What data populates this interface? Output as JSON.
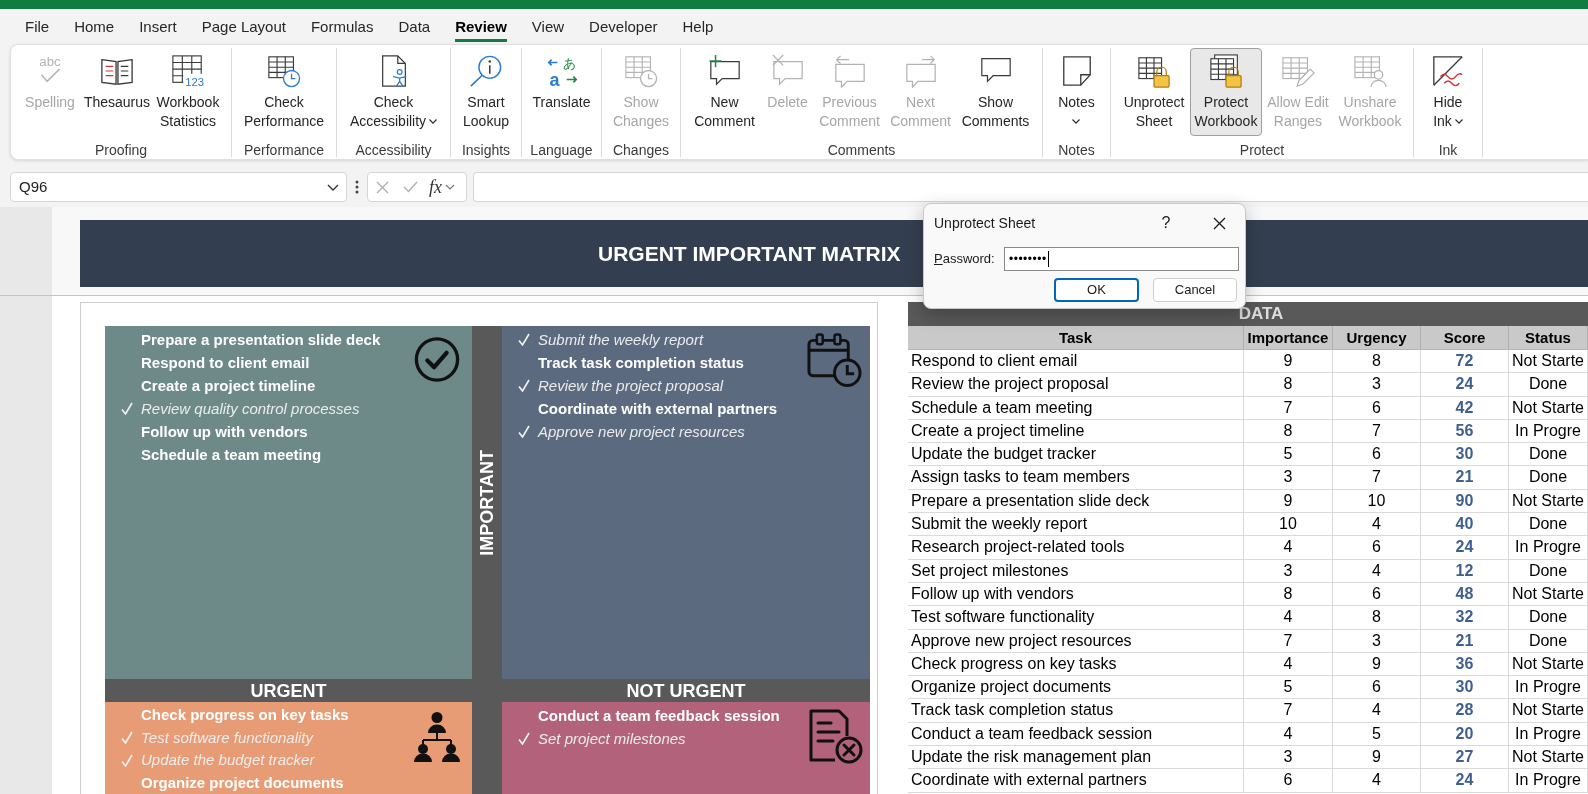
{
  "menu_tabs": [
    {
      "label": "File",
      "selected": false
    },
    {
      "label": "Home",
      "selected": false
    },
    {
      "label": "Insert",
      "selected": false
    },
    {
      "label": "Page Layout",
      "selected": false
    },
    {
      "label": "Formulas",
      "selected": false
    },
    {
      "label": "Data",
      "selected": false
    },
    {
      "label": "Review",
      "selected": true
    },
    {
      "label": "View",
      "selected": false
    },
    {
      "label": "Developer",
      "selected": false
    },
    {
      "label": "Help",
      "selected": false
    }
  ],
  "ribbon": {
    "groups": [
      {
        "label": "Proofing",
        "buttons": [
          {
            "lines": [
              "Spelling"
            ],
            "icon_text": [
              "abc"
            ],
            "disabled": true,
            "pressed": false,
            "dropdown": false
          },
          {
            "lines": [
              "Thesaurus"
            ],
            "disabled": false,
            "pressed": false,
            "dropdown": false
          },
          {
            "lines": [
              "Workbook",
              "Statistics"
            ],
            "icon_text": [
              "123"
            ],
            "disabled": false,
            "pressed": false,
            "dropdown": false
          }
        ]
      },
      {
        "label": "Performance",
        "buttons": [
          {
            "lines": [
              "Check",
              "Performance"
            ],
            "disabled": false,
            "pressed": false,
            "dropdown": false
          }
        ]
      },
      {
        "label": "Accessibility",
        "buttons": [
          {
            "lines": [
              "Check",
              "Accessibility"
            ],
            "disabled": false,
            "pressed": false,
            "dropdown": true
          }
        ]
      },
      {
        "label": "Insights",
        "buttons": [
          {
            "lines": [
              "Smart",
              "Lookup"
            ],
            "disabled": false,
            "pressed": false,
            "dropdown": false
          }
        ]
      },
      {
        "label": "Language",
        "buttons": [
          {
            "lines": [
              "Translate"
            ],
            "icon_text": [
              "a",
              "あ"
            ],
            "disabled": false,
            "pressed": false,
            "dropdown": false
          }
        ]
      },
      {
        "label": "Changes",
        "buttons": [
          {
            "lines": [
              "Show",
              "Changes"
            ],
            "disabled": true,
            "pressed": false,
            "dropdown": false
          }
        ]
      },
      {
        "label": "Comments",
        "buttons": [
          {
            "lines": [
              "New",
              "Comment"
            ],
            "disabled": false,
            "pressed": false,
            "dropdown": false
          },
          {
            "lines": [
              "Delete"
            ],
            "disabled": true,
            "pressed": false,
            "dropdown": false
          },
          {
            "lines": [
              "Previous",
              "Comment"
            ],
            "disabled": true,
            "pressed": false,
            "dropdown": false
          },
          {
            "lines": [
              "Next",
              "Comment"
            ],
            "disabled": true,
            "pressed": false,
            "dropdown": false
          },
          {
            "lines": [
              "Show",
              "Comments"
            ],
            "disabled": false,
            "pressed": false,
            "dropdown": false
          }
        ]
      },
      {
        "label": "Notes",
        "buttons": [
          {
            "lines": [
              "Notes"
            ],
            "disabled": false,
            "pressed": false,
            "dropdown": true
          }
        ]
      },
      {
        "label": "Protect",
        "buttons": [
          {
            "lines": [
              "Unprotect",
              "Sheet"
            ],
            "disabled": false,
            "pressed": false,
            "dropdown": false
          },
          {
            "lines": [
              "Protect",
              "Workbook"
            ],
            "disabled": false,
            "pressed": true,
            "dropdown": false
          },
          {
            "lines": [
              "Allow Edit",
              "Ranges"
            ],
            "disabled": true,
            "pressed": false,
            "dropdown": false
          },
          {
            "lines": [
              "Unshare",
              "Workbook"
            ],
            "disabled": true,
            "pressed": false,
            "dropdown": false
          }
        ]
      },
      {
        "label": "Ink",
        "buttons": [
          {
            "lines": [
              "Hide",
              "Ink"
            ],
            "disabled": false,
            "pressed": false,
            "dropdown": true
          }
        ]
      }
    ]
  },
  "formula_bar": {
    "name_box": "Q96",
    "function_button": "fx"
  },
  "sheet": {
    "title": "URGENT IMPORTANT MATRIX",
    "matrix": {
      "row_label": "IMPORTANT",
      "column_labels": [
        "URGENT",
        "NOT URGENT"
      ],
      "quadrants": [
        {
          "color": "#6d8a88",
          "items": [
            {
              "text": "Prepare a presentation slide deck",
              "checked": false
            },
            {
              "text": "Respond to client email",
              "checked": false
            },
            {
              "text": "Create a project timeline",
              "checked": false
            },
            {
              "text": "Review quality control processes",
              "checked": true
            },
            {
              "text": "Follow up with vendors",
              "checked": false
            },
            {
              "text": "Schedule a team meeting",
              "checked": false
            }
          ]
        },
        {
          "color": "#5c6a7f",
          "items": [
            {
              "text": "Submit the weekly report",
              "checked": true
            },
            {
              "text": "Track task completion status",
              "checked": false
            },
            {
              "text": "Review the project proposal",
              "checked": true
            },
            {
              "text": "Coordinate with external partners",
              "checked": false
            },
            {
              "text": "Approve new project resources",
              "checked": true
            }
          ]
        },
        {
          "color": "#e79c75",
          "items": [
            {
              "text": "Check progress on key tasks",
              "checked": false
            },
            {
              "text": "Test software functionality",
              "checked": true
            },
            {
              "text": "Update the budget tracker",
              "checked": true
            },
            {
              "text": "Organize project documents",
              "checked": false
            }
          ]
        },
        {
          "color": "#b2627a",
          "items": [
            {
              "text": "Conduct a team feedback session",
              "checked": false
            },
            {
              "text": "Set project milestones",
              "checked": true
            }
          ]
        }
      ]
    },
    "table": {
      "title": "DATA",
      "columns": [
        "Task",
        "Importance",
        "Urgency",
        "Score",
        "Status"
      ],
      "rows": [
        {
          "task": "Respond to client email",
          "importance": "9",
          "urgency": "8",
          "score": "72",
          "status": "Not Starte"
        },
        {
          "task": "Review the project proposal",
          "importance": "8",
          "urgency": "3",
          "score": "24",
          "status": "Done"
        },
        {
          "task": "Schedule a team meeting",
          "importance": "7",
          "urgency": "6",
          "score": "42",
          "status": "Not Starte"
        },
        {
          "task": "Create a project timeline",
          "importance": "8",
          "urgency": "7",
          "score": "56",
          "status": "In Progre"
        },
        {
          "task": "Update the budget tracker",
          "importance": "5",
          "urgency": "6",
          "score": "30",
          "status": "Done"
        },
        {
          "task": "Assign tasks to team members",
          "importance": "3",
          "urgency": "7",
          "score": "21",
          "status": "Done"
        },
        {
          "task": "Prepare a presentation slide deck",
          "importance": "9",
          "urgency": "10",
          "score": "90",
          "status": "Not Starte"
        },
        {
          "task": "Submit the weekly report",
          "importance": "10",
          "urgency": "4",
          "score": "40",
          "status": "Done"
        },
        {
          "task": "Research project-related tools",
          "importance": "4",
          "urgency": "6",
          "score": "24",
          "status": "In Progre"
        },
        {
          "task": "Set project milestones",
          "importance": "3",
          "urgency": "4",
          "score": "12",
          "status": "Done"
        },
        {
          "task": "Follow up with vendors",
          "importance": "8",
          "urgency": "6",
          "score": "48",
          "status": "Not Starte"
        },
        {
          "task": "Test software functionality",
          "importance": "4",
          "urgency": "8",
          "score": "32",
          "status": "Done"
        },
        {
          "task": "Approve new project resources",
          "importance": "7",
          "urgency": "3",
          "score": "21",
          "status": "Done"
        },
        {
          "task": "Check progress on key tasks",
          "importance": "4",
          "urgency": "9",
          "score": "36",
          "status": "Not Starte"
        },
        {
          "task": "Organize project documents",
          "importance": "5",
          "urgency": "6",
          "score": "30",
          "status": "In Progre"
        },
        {
          "task": "Track task completion status",
          "importance": "7",
          "urgency": "4",
          "score": "28",
          "status": "Not Starte"
        },
        {
          "task": "Conduct a team feedback session",
          "importance": "4",
          "urgency": "5",
          "score": "20",
          "status": "In Progre"
        },
        {
          "task": "Update the risk management plan",
          "importance": "3",
          "urgency": "9",
          "score": "27",
          "status": "Not Starte"
        },
        {
          "task": "Coordinate with external partners",
          "importance": "6",
          "urgency": "4",
          "score": "24",
          "status": "In Progre"
        }
      ]
    }
  },
  "dialog": {
    "title": "Unprotect Sheet",
    "help_button": "?",
    "password_label": "Password:",
    "password_value": "••••••••",
    "buttons": [
      {
        "label": "OK",
        "default": true
      },
      {
        "label": "Cancel",
        "default": false
      }
    ]
  }
}
